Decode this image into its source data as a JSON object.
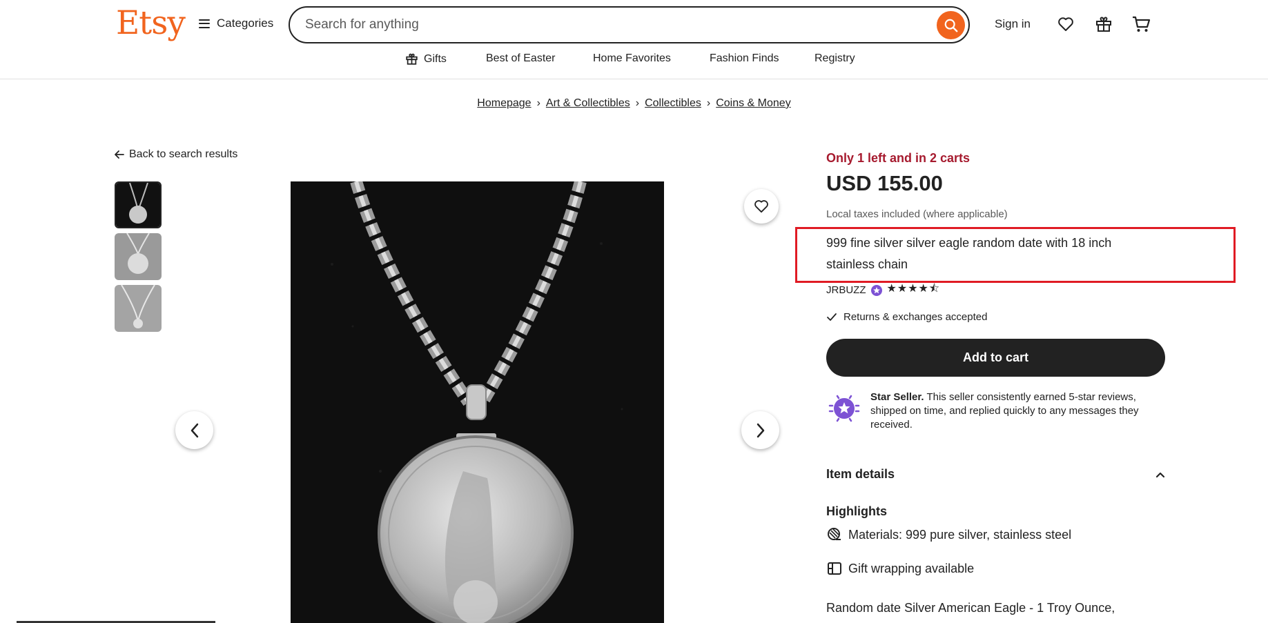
{
  "header": {
    "logo": "Etsy",
    "categories_label": "Categories",
    "search_placeholder": "Search for anything",
    "signin_label": "Sign in",
    "subnav": [
      "Gifts",
      "Best of Easter",
      "Home Favorites",
      "Fashion Finds",
      "Registry"
    ]
  },
  "breadcrumb": [
    "Homepage",
    "Art & Collectibles",
    "Collectibles",
    "Coins & Money"
  ],
  "gallery": {
    "back_label": "Back to search results",
    "thumbnail_count": 3
  },
  "product": {
    "stock_notice": "Only 1 left and in 2 carts",
    "price": "USD 155.00",
    "taxes_note": "Local taxes included (where applicable)",
    "title": "999 fine silver silver eagle random date with 18 inch stainless chain",
    "seller_name": "JRBUZZ",
    "rating_stars": 4.5,
    "returns_note": "Returns & exchanges accepted",
    "add_to_cart_label": "Add to cart",
    "star_seller_heading": "Star Seller.",
    "star_seller_text": " This seller consistently earned 5-star reviews, shipped on time, and replied quickly to any messages they received.",
    "item_details_label": "Item details",
    "highlights_label": "Highlights",
    "materials_prefix": "Materials: ",
    "materials_value": "999 pure silver, stainless steel",
    "gift_wrapping": "Gift wrapping available",
    "description_start": "Random date Silver American Eagle - 1 Troy Ounce,"
  },
  "colors": {
    "brand": "#f1641e",
    "stock_red": "#a61a2e",
    "highlight_box": "#e01b24",
    "star_seller_purple": "#7d52d4"
  }
}
